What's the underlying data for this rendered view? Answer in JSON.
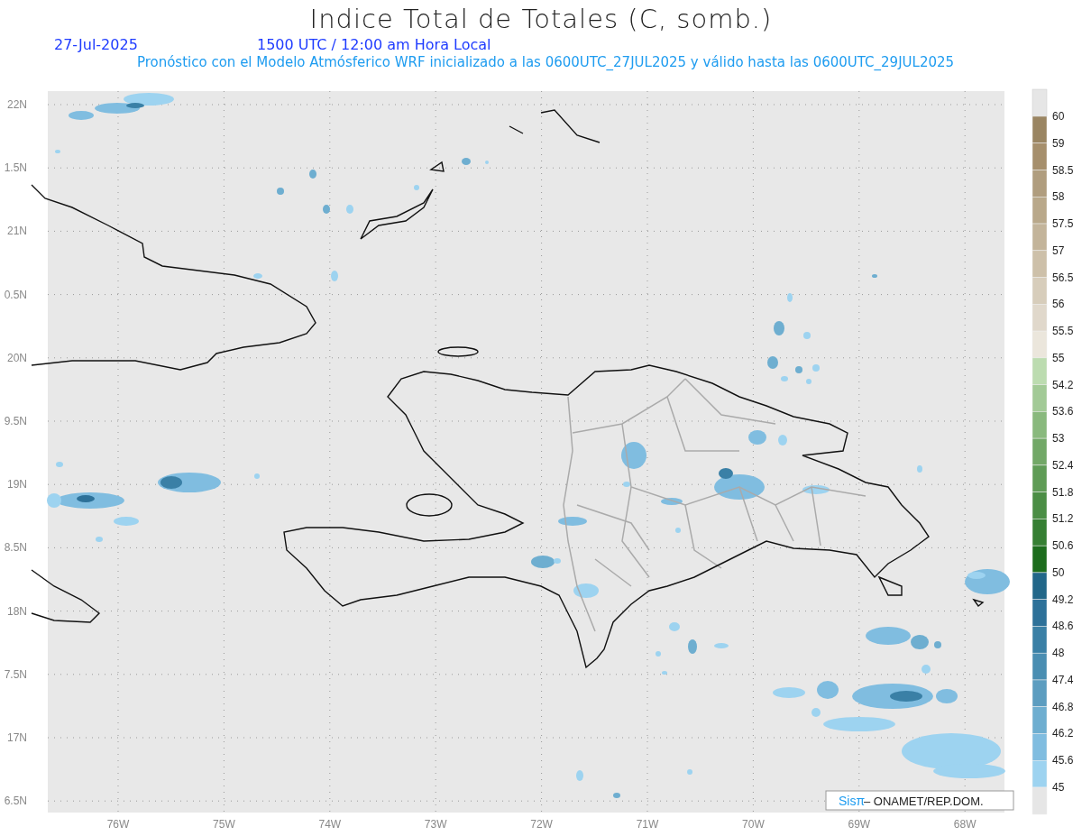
{
  "title": "Indice Total de Totales (C, somb.)",
  "date": "27-Jul-2025",
  "time": "1500 UTC / 12:00 am Hora Local",
  "subtitle": "Pronóstico con el Modelo Atmósferico WRF inicializado a las 0600UTC_27JUL2025 y válido hasta las  0600UTC_29JUL2025",
  "lat_labels": [
    "22N",
    "1.5N",
    "21N",
    "0.5N",
    "20N",
    "9.5N",
    "19N",
    "8.5N",
    "18N",
    "7.5N",
    "17N",
    "6.5N"
  ],
  "lon_labels": [
    "76W",
    "75W",
    "74W",
    "73W",
    "72W",
    "71W",
    "70W",
    "69W",
    "68W"
  ],
  "colorbar": [
    {
      "label": "60",
      "color": "#9a8562"
    },
    {
      "label": "59",
      "color": "#a68f6c"
    },
    {
      "label": "58.5",
      "color": "#b09d7e"
    },
    {
      "label": "58",
      "color": "#b9a88a"
    },
    {
      "label": "57.5",
      "color": "#c3b49a"
    },
    {
      "label": "57",
      "color": "#cdc0a9"
    },
    {
      "label": "56.5",
      "color": "#d7cdbb"
    },
    {
      "label": "56",
      "color": "#e0d8cb"
    },
    {
      "label": "55.5",
      "color": "#ebe6dc"
    },
    {
      "label": "55",
      "color": "#bcdcb0"
    },
    {
      "label": "54.2",
      "color": "#a2ca96"
    },
    {
      "label": "53.6",
      "color": "#89b97d"
    },
    {
      "label": "53",
      "color": "#72a867"
    },
    {
      "label": "52.4",
      "color": "#5f9c56"
    },
    {
      "label": "51.8",
      "color": "#4b8e45"
    },
    {
      "label": "51.2",
      "color": "#367f33"
    },
    {
      "label": "50.6",
      "color": "#1d6d1d"
    },
    {
      "label": "50",
      "color": "#226789"
    },
    {
      "label": "49.2",
      "color": "#2d7199"
    },
    {
      "label": "48.6",
      "color": "#3a80a6"
    },
    {
      "label": "48",
      "color": "#4a8eb2"
    },
    {
      "label": "47.4",
      "color": "#5c9dc0"
    },
    {
      "label": "46.8",
      "color": "#6eaed0"
    },
    {
      "label": "46.2",
      "color": "#80bde0"
    },
    {
      "label": "45.6",
      "color": "#9dd3f0"
    },
    {
      "label": "45",
      "color": "#e6e6e6"
    }
  ],
  "credit": {
    "brand": "Sisπ",
    "text": "– ONAMET/REP.DOM."
  }
}
